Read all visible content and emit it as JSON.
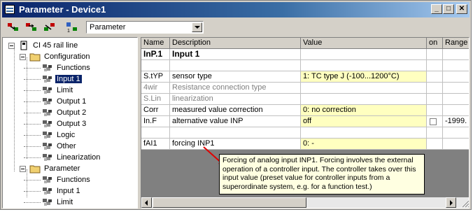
{
  "window": {
    "title": "Parameter - Device1"
  },
  "titlebar_buttons": [
    "_",
    "□",
    "✕"
  ],
  "toolbar": {
    "combo_value": "Parameter",
    "icons": [
      "red-green-marker-icon-1",
      "red-green-marker-icon-2",
      "red-green-marker-icon-3",
      "blue-marker-icon"
    ]
  },
  "tree": [
    {
      "label": "CI 45 rail line",
      "level": 0,
      "icon": "device-icon",
      "expander": true
    },
    {
      "label": "Configuration",
      "level": 1,
      "icon": "folder-icon",
      "expander": true
    },
    {
      "label": "Functions",
      "level": 2,
      "icon": "parameter-icon"
    },
    {
      "label": "Input 1",
      "level": 2,
      "icon": "parameter-icon",
      "selected": true
    },
    {
      "label": "Limit",
      "level": 2,
      "icon": "parameter-icon"
    },
    {
      "label": "Output 1",
      "level": 2,
      "icon": "parameter-icon"
    },
    {
      "label": "Output 2",
      "level": 2,
      "icon": "parameter-icon"
    },
    {
      "label": "Output 3",
      "level": 2,
      "icon": "parameter-icon"
    },
    {
      "label": "Logic",
      "level": 2,
      "icon": "parameter-icon"
    },
    {
      "label": "Other",
      "level": 2,
      "icon": "parameter-icon"
    },
    {
      "label": "Linearization",
      "level": 2,
      "icon": "parameter-icon"
    },
    {
      "label": "Parameter",
      "level": 1,
      "icon": "folder-icon",
      "expander": true
    },
    {
      "label": "Functions",
      "level": 2,
      "icon": "parameter-icon"
    },
    {
      "label": "Input 1",
      "level": 2,
      "icon": "parameter-icon"
    },
    {
      "label": "Limit",
      "level": 2,
      "icon": "parameter-icon"
    }
  ],
  "grid": {
    "columns": [
      "Name",
      "Description",
      "Value",
      "on",
      "Range"
    ],
    "rows": [
      {
        "name": "InP.1",
        "description": "Input 1",
        "value": "",
        "on": "",
        "range": "",
        "style": "section"
      },
      {
        "name": "",
        "description": "",
        "value": "",
        "on": "",
        "range": "",
        "style": "blank"
      },
      {
        "name": "S.tYP",
        "description": "sensor type",
        "value": "1: TC type J (-100...1200°C)",
        "on": "",
        "range": "",
        "style": "editable"
      },
      {
        "name": "4wir",
        "description": "Resistance connection type",
        "value": "",
        "on": "",
        "range": "",
        "style": "disabled"
      },
      {
        "name": "S.Lin",
        "description": "linearization",
        "value": "",
        "on": "",
        "range": "",
        "style": "disabled"
      },
      {
        "name": "Corr",
        "description": "measured value correction",
        "value": "0: no correction",
        "on": "",
        "range": "",
        "style": "editable"
      },
      {
        "name": "In.F",
        "description": "alternative value INP",
        "value": "off",
        "on": "checkbox",
        "range": "-1999.",
        "style": "editable"
      },
      {
        "name": "",
        "description": "",
        "value": "",
        "on": "",
        "range": "",
        "style": "blank"
      },
      {
        "name": "fAI1",
        "description": "forcing INP1",
        "value": "0: -",
        "on": "",
        "range": "",
        "style": "editable"
      }
    ]
  },
  "tooltip": {
    "text": "Forcing of analog input INP1. Forcing involves the external operation of a controller input. The controller takes over this input value (preset value for controller inputs from a superordinate system, e.g. for a function test.)"
  },
  "colors": {
    "title_start": "#0a246a",
    "title_end": "#a6caf0",
    "value_cell": "#ffffc0",
    "tooltip_bg": "#ffffe1",
    "arrow": "#e00000"
  }
}
